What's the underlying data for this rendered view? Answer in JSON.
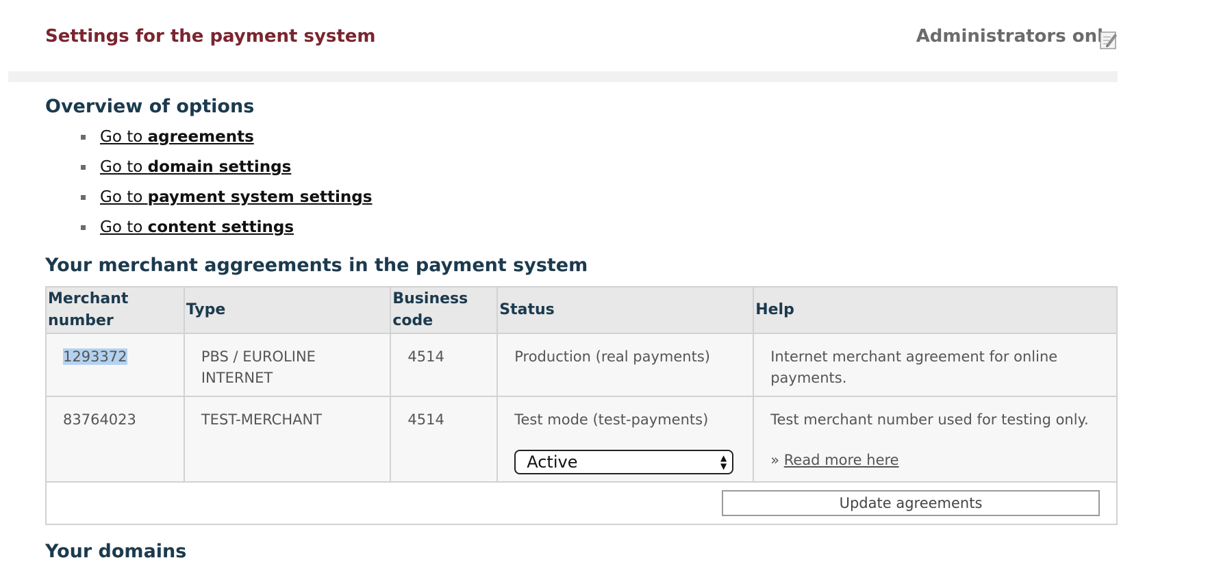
{
  "header": {
    "title": "Settings for the payment system",
    "admin_label": "Administrators only",
    "edit_icon": "edit-icon"
  },
  "overview": {
    "heading": "Overview of options",
    "items": [
      {
        "prefix": "Go to ",
        "target": "agreements"
      },
      {
        "prefix": "Go to ",
        "target": "domain settings"
      },
      {
        "prefix": "Go to ",
        "target": "payment system settings"
      },
      {
        "prefix": "Go to ",
        "target": "content settings"
      }
    ]
  },
  "merchants": {
    "heading": "Your merchant aggreements in the payment system",
    "columns": [
      "Merchant number",
      "Type",
      "Business code",
      "Status",
      "Help"
    ],
    "rows": [
      {
        "number": "1293372",
        "type": "PBS / EUROLINE INTERNET",
        "code": "4514",
        "status": "Production (real payments)",
        "help": "Internet merchant agreement for online payments."
      },
      {
        "number": "83764023",
        "type": "TEST-MERCHANT",
        "code": "4514",
        "status": "Test mode (test-payments)",
        "status_select": "Active",
        "help": "Test merchant number used for testing only.",
        "read_more_prefix": "» ",
        "read_more": "Read more here"
      }
    ],
    "update_button": "Update agreements"
  },
  "domains": {
    "heading": "Your domains"
  },
  "colors": {
    "title": "#7a2530",
    "heading": "#1c3a4e",
    "table_header_bg": "#e8e8e8",
    "selection": "#b4d2f0"
  }
}
